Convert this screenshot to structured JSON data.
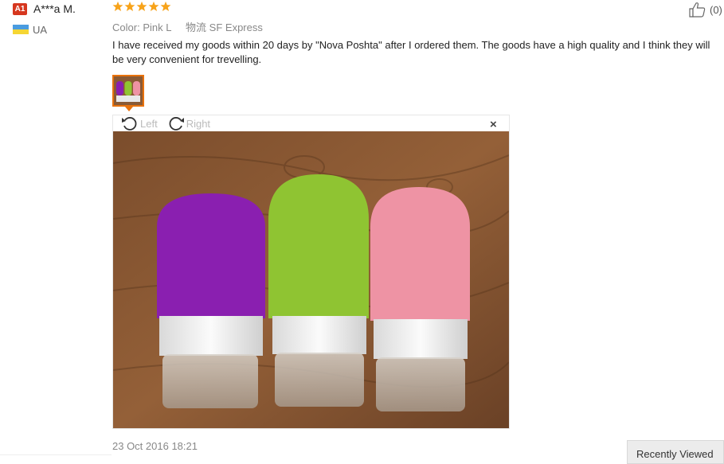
{
  "reviewer": {
    "badge": "A1",
    "name": "A***a M.",
    "country": "UA"
  },
  "rating": {
    "stars": 5,
    "max": 5,
    "color": "#f7a31a"
  },
  "helpful": {
    "count": "(0)"
  },
  "meta": {
    "color_label": "Color:",
    "color_value": "Pink L",
    "logistics_label": "物流",
    "logistics_value": "SF Express"
  },
  "review_text": "I have received my goods within 20 days by \"Nova Poshta\" after I ordered them. The goods have a high quality and I think they will be very convenient for trevelling.",
  "viewer": {
    "rotate_left": "Left",
    "rotate_right": "Right",
    "close": "×"
  },
  "date": "23 Oct 2016 18:21",
  "recently_viewed": "Recently Viewed",
  "colors": {
    "badge_red": "#d6371f",
    "accent_orange": "#e8720c",
    "bottle_purple": "#8a1fb0",
    "bottle_green": "#8fc432",
    "bottle_pink": "#ee93a4"
  }
}
